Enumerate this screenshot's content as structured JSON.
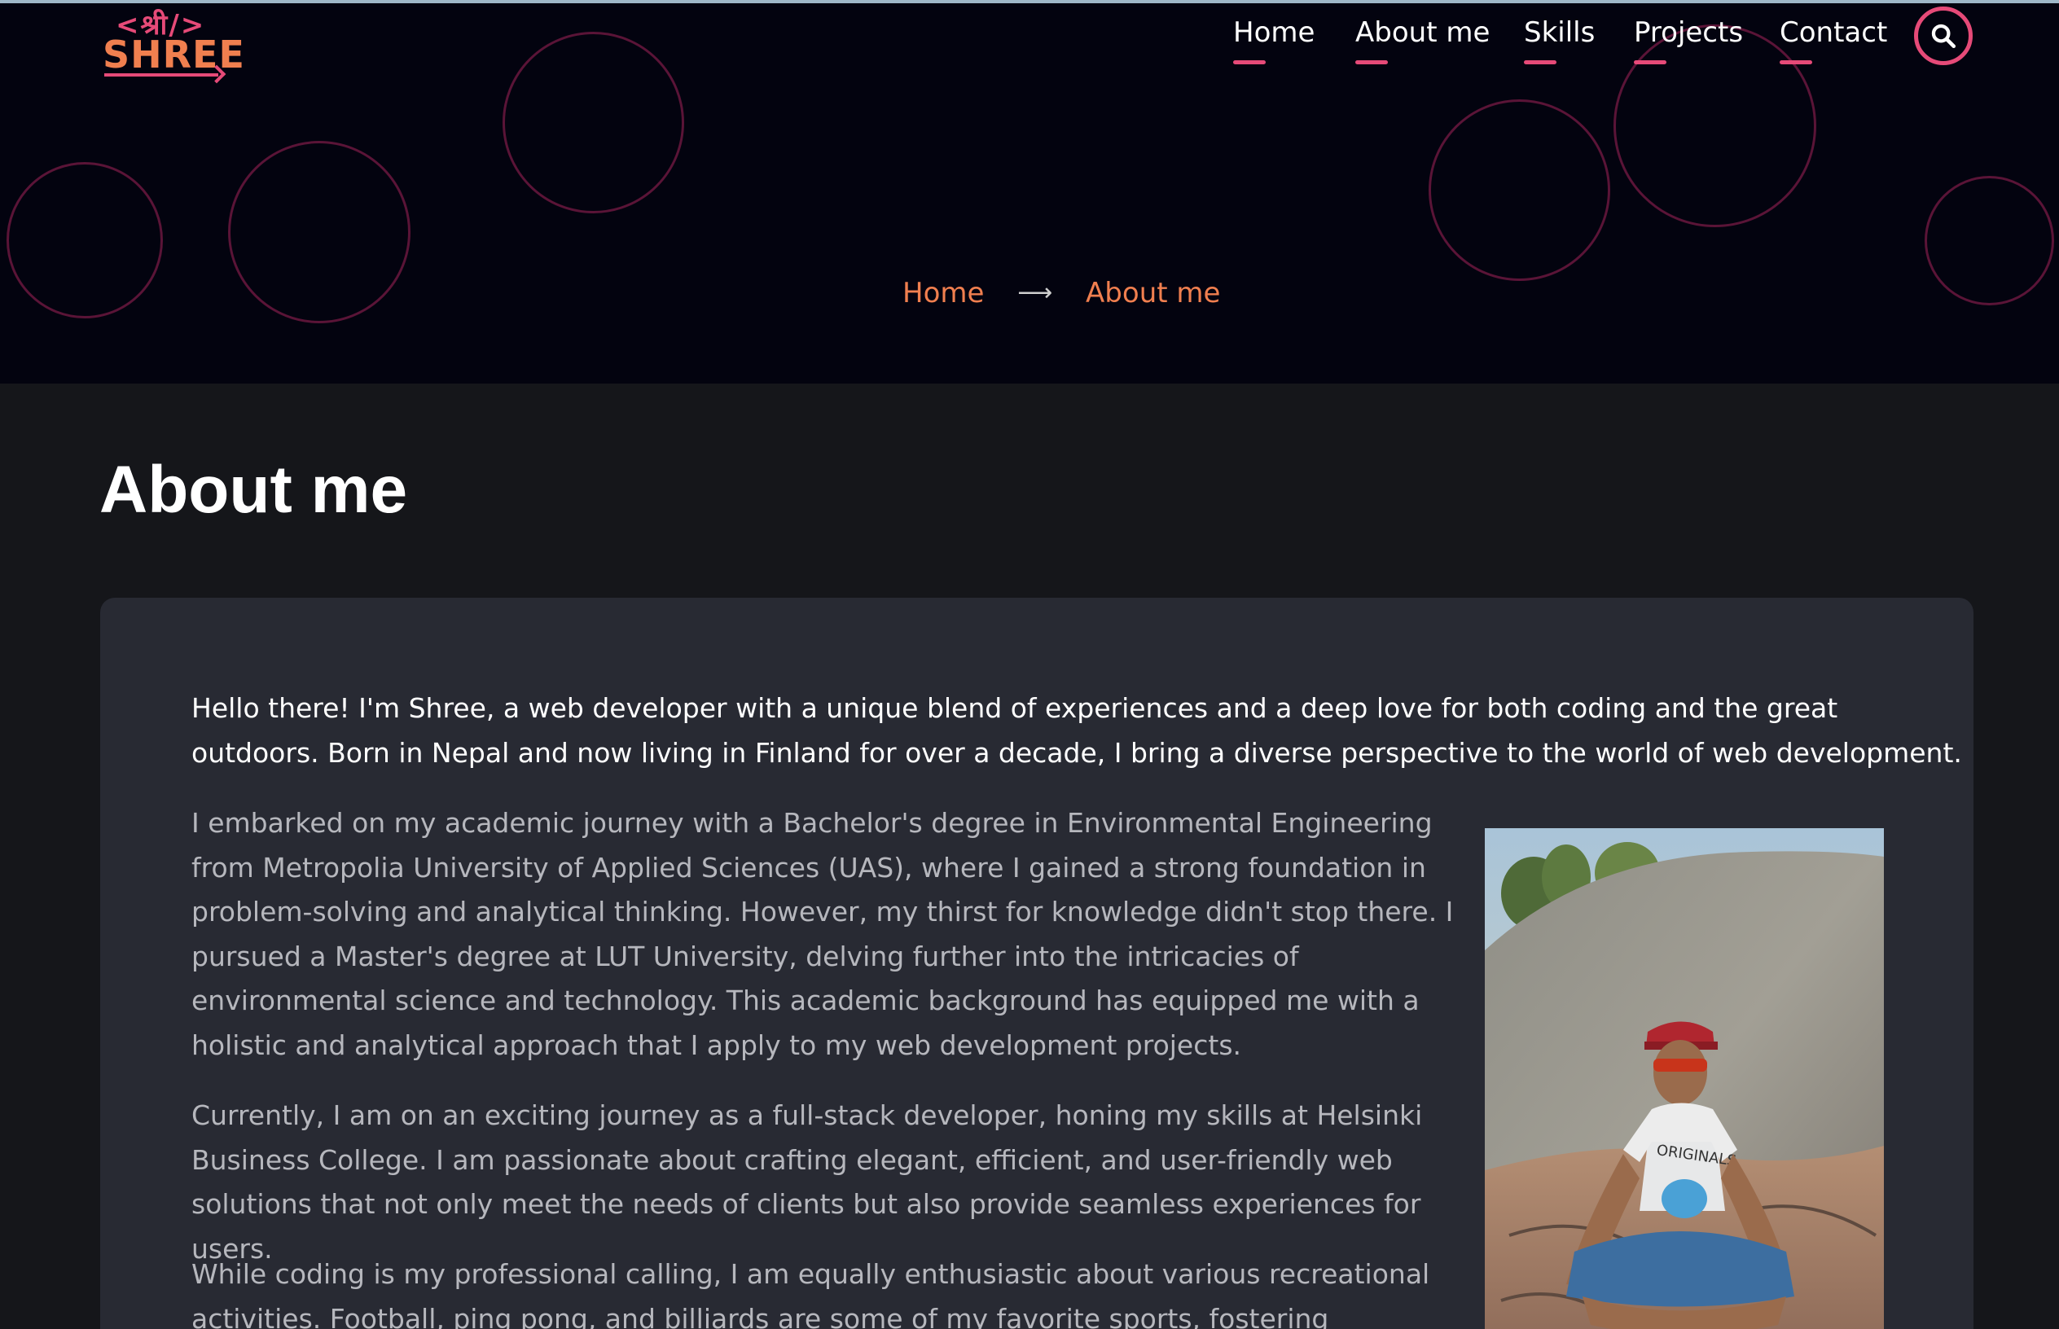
{
  "brand": {
    "logo_top": "<श्री/>",
    "logo_name": "SHREE"
  },
  "nav": {
    "items": [
      {
        "label": "Home"
      },
      {
        "label": "About me"
      },
      {
        "label": "Skills"
      },
      {
        "label": "Projects"
      },
      {
        "label": "Contact"
      }
    ],
    "search_icon": "search-icon"
  },
  "breadcrumb": {
    "home": "Home",
    "separator": "⟶",
    "current": "About me"
  },
  "page": {
    "title": "About me",
    "intro": "Hello there! I'm Shree, a web developer with a unique blend of experiences and a deep love for both coding and the great outdoors. Born in Nepal and now living in Finland for over a decade, I bring a diverse perspective to the world of web development.",
    "paragraphs": [
      "I embarked on my academic journey with a Bachelor's degree in Environmental Engineering from Metropolia University of Applied Sciences (UAS), where I gained a strong foundation in problem-solving and analytical thinking. However, my thirst for knowledge didn't stop there. I pursued a Master's degree at LUT University, delving further into the intricacies of environmental science and technology. This academic background has equipped me with a holistic and analytical approach that I apply to my web development projects.",
      "Currently, I am on an exciting journey as a full-stack developer, honing my skills at Helsinki Business College. I am passionate about crafting elegant, efficient, and user-friendly web solutions that not only meet the needs of clients but also provide seamless experiences for users.",
      "While coding is my professional calling, I am equally enthusiastic about various recreational activities. Football, ping pong, and billiards are some of my favorite sports, fostering teamwork, competitiveness,"
    ],
    "photo_tshirt_text": "ORIGINALS"
  },
  "colors": {
    "accent_pink": "#e64a78",
    "accent_orange": "#f07f4f",
    "hero_bg": "#03030f",
    "page_bg": "#15161a",
    "card_bg": "#282a33"
  }
}
